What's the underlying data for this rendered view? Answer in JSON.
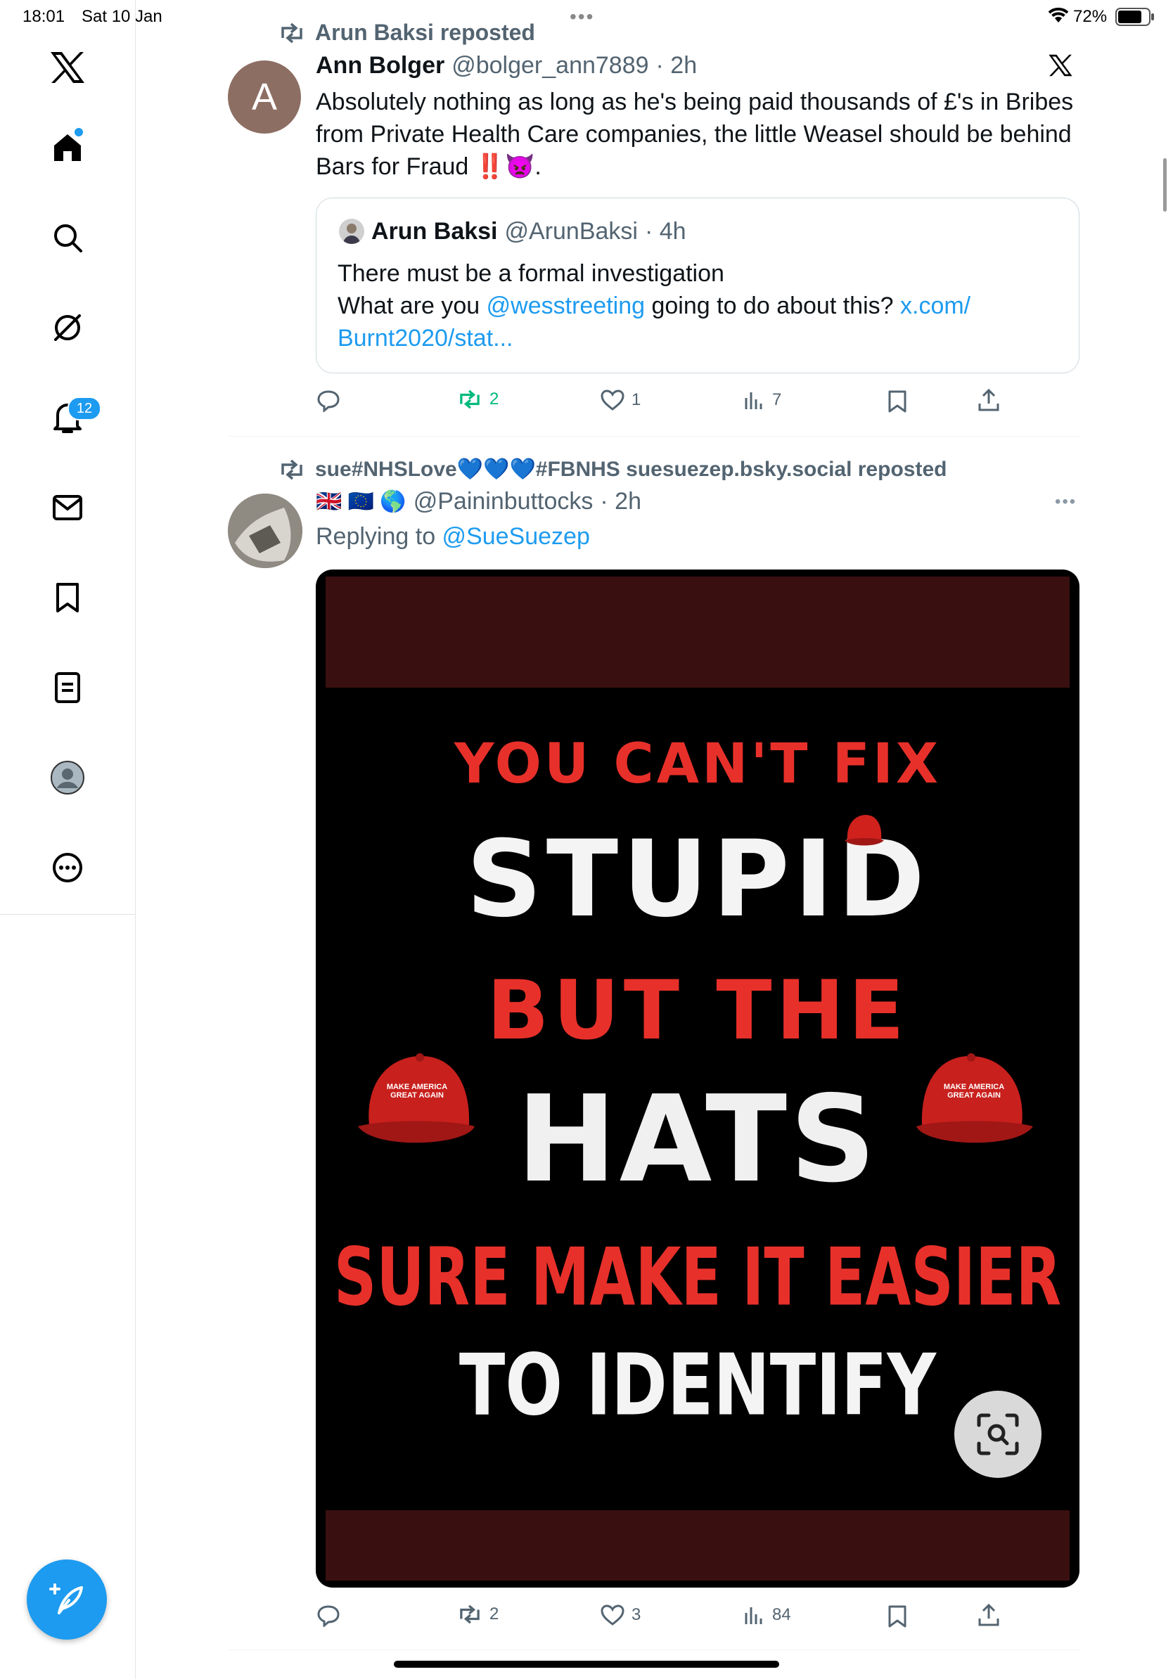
{
  "status_bar": {
    "time": "18:01",
    "date": "Sat 10 Jan",
    "battery": "72%"
  },
  "nav": {
    "items": [
      "x-logo",
      "home",
      "search",
      "grok",
      "notifications",
      "messages",
      "bookmarks",
      "lists",
      "profile",
      "more"
    ],
    "notification_count": "12"
  },
  "post1": {
    "repost_label": "Arun Baksi reposted",
    "avatar_letter": "A",
    "name": "Ann Bolger",
    "handle": "@bolger_ann7889",
    "time": "· 2h",
    "text_lines": [
      "Absolutely nothing as long as he's being paid thousands of £'s in Bribes",
      "from Private Health Care companies, the little Weasel should be behind"
    ],
    "text_line3": "Bars for Fraud ‼️👿.",
    "quote": {
      "name": "Arun Baksi",
      "handle": "@ArunBaksi",
      "time": "· 4h",
      "line1": "There must be a formal investigation",
      "line2_pre": "What are you ",
      "mention": "@wesstreeting",
      "line2_mid": " going to do about this? ",
      "url1": "x.com/",
      "url2": "Burnt2020/stat..."
    },
    "stats": {
      "reposts": "2",
      "likes": "1",
      "views": "7"
    }
  },
  "post2": {
    "repost_label": "sue#NHSLove💙💙💙#FBNHS suesuezep.bsky.social reposted",
    "flags": "🇬🇧 🇪🇺 🌎",
    "handle": "@Paininbuttocks",
    "time": "· 2h",
    "reply_prefix": "Replying to ",
    "reply_to": "@SueSuezep",
    "image_text": {
      "line1": "YOU CAN'T FIX",
      "line2": "STUPID",
      "line3": "BUT THE",
      "line4": "HATS",
      "line5": "SURE MAKE IT EASIER",
      "line6": "TO IDENTIFY",
      "cap_text": "MAKE AMERICA GREAT AGAIN"
    },
    "stats": {
      "reposts": "2",
      "likes": "3",
      "views": "84"
    }
  },
  "colors": {
    "accent": "#1d9bf0",
    "repost_green": "#00ba7c",
    "poster_red": "#e8302a"
  }
}
